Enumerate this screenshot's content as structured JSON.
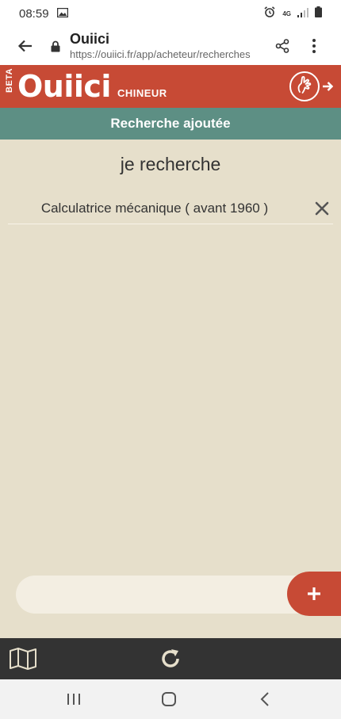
{
  "status_bar": {
    "time": "08:59",
    "network": "4G"
  },
  "browser": {
    "title": "Ouiici",
    "url": "https://ouiici.fr/app/acheteur/recherches",
    "back_icon": "arrow-left-icon",
    "share_icon": "share-icon",
    "menu_icon": "more-vert-icon"
  },
  "header": {
    "beta": "BETA",
    "logo": "Ouiici",
    "subtitle": "CHINEUR",
    "accent": "#c74a35"
  },
  "banner": {
    "text": "Recherche ajoutée",
    "color": "#5d8f84"
  },
  "main": {
    "title": "je recherche",
    "searches": [
      {
        "label": "Calculatrice mécanique ( avant 1960 )"
      }
    ]
  },
  "add": {
    "input_value": "",
    "button_icon": "plus-icon"
  },
  "bottom_bar": {
    "map_icon": "map-icon",
    "refresh_icon": "refresh-icon"
  },
  "colors": {
    "background": "#e6dfcb",
    "bottom_bar": "#333333"
  }
}
